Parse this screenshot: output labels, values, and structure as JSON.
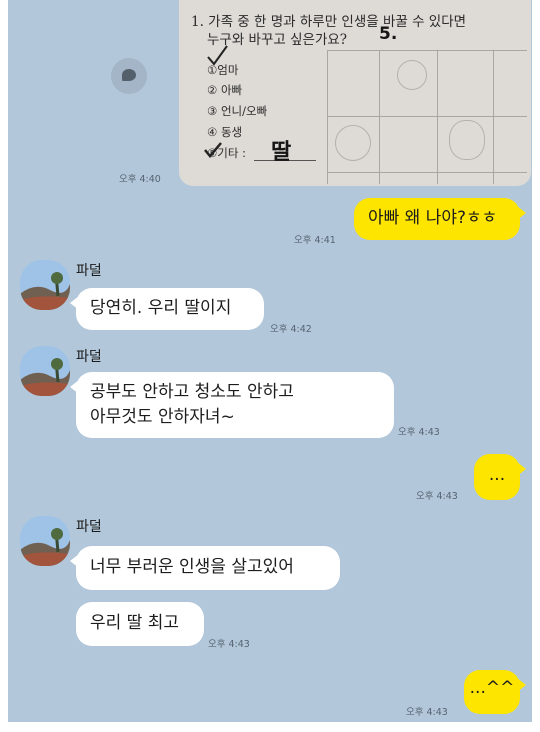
{
  "colors": {
    "chat_background": "#b2c7da",
    "my_bubble": "#fee500",
    "friend_bubble": "#ffffff",
    "timestamp": "#566472"
  },
  "photo_message": {
    "question": "1. 가족 중 한 명과 하루만 인생을 바꿀 수 있다면",
    "question_line2": "누구와 바꾸고 싶은가요?",
    "handwritten_answer_number": "5.",
    "options": [
      "①엄마",
      "② 아빠",
      "③ 언니/오빠",
      "④ 동생",
      "⑤기타 :"
    ],
    "handwritten_other": "딸",
    "time": "오후 4:40",
    "share_icon": "speech-bubble-share-icon"
  },
  "messages": [
    {
      "sender": "me",
      "text": "아빠 왜 나야?ㅎㅎ",
      "time": "오후 4:41"
    },
    {
      "sender": "friend",
      "name": "파덜",
      "text": "당연히. 우리 딸이지",
      "time": "오후 4:42"
    },
    {
      "sender": "friend",
      "name": "파덜",
      "lines": [
        "공부도 안하고 청소도 안하고",
        "아무것도 안하자녀~"
      ],
      "time": "오후 4:43"
    },
    {
      "sender": "me",
      "text": "...",
      "time": "오후 4:43"
    },
    {
      "sender": "friend",
      "name": "파덜",
      "text": "너무 부러운 인생을 살고있어"
    },
    {
      "sender": "friend",
      "text": "우리 딸 최고",
      "time": "오후 4:43"
    },
    {
      "sender": "me",
      "text": "...^^",
      "time": "오후 4:43"
    }
  ]
}
